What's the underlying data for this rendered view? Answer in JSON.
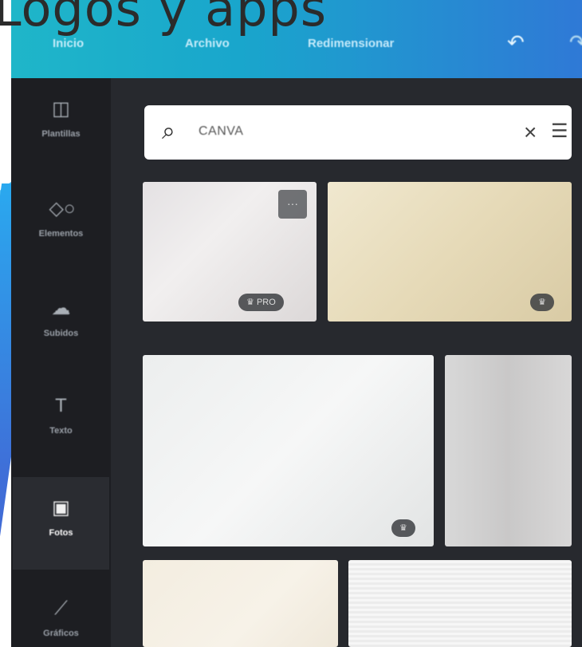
{
  "slide": {
    "title": "Logos y apps"
  },
  "topbar": {
    "items": [
      "Inicio",
      "Archivo",
      "Redimensionar"
    ]
  },
  "sidebar": {
    "items": [
      {
        "label": "Plantillas",
        "icon": "layout-icon"
      },
      {
        "label": "Elementos",
        "icon": "shapes-icon"
      },
      {
        "label": "Subidos",
        "icon": "cloud-upload-icon"
      },
      {
        "label": "Texto",
        "icon": "text-icon"
      },
      {
        "label": "Fotos",
        "icon": "photo-icon"
      },
      {
        "label": "Gráficos",
        "icon": "chart-icon"
      }
    ],
    "active": "Fotos"
  },
  "search": {
    "value": "CANVA"
  },
  "results": {
    "tile1_badge": "PRO"
  }
}
